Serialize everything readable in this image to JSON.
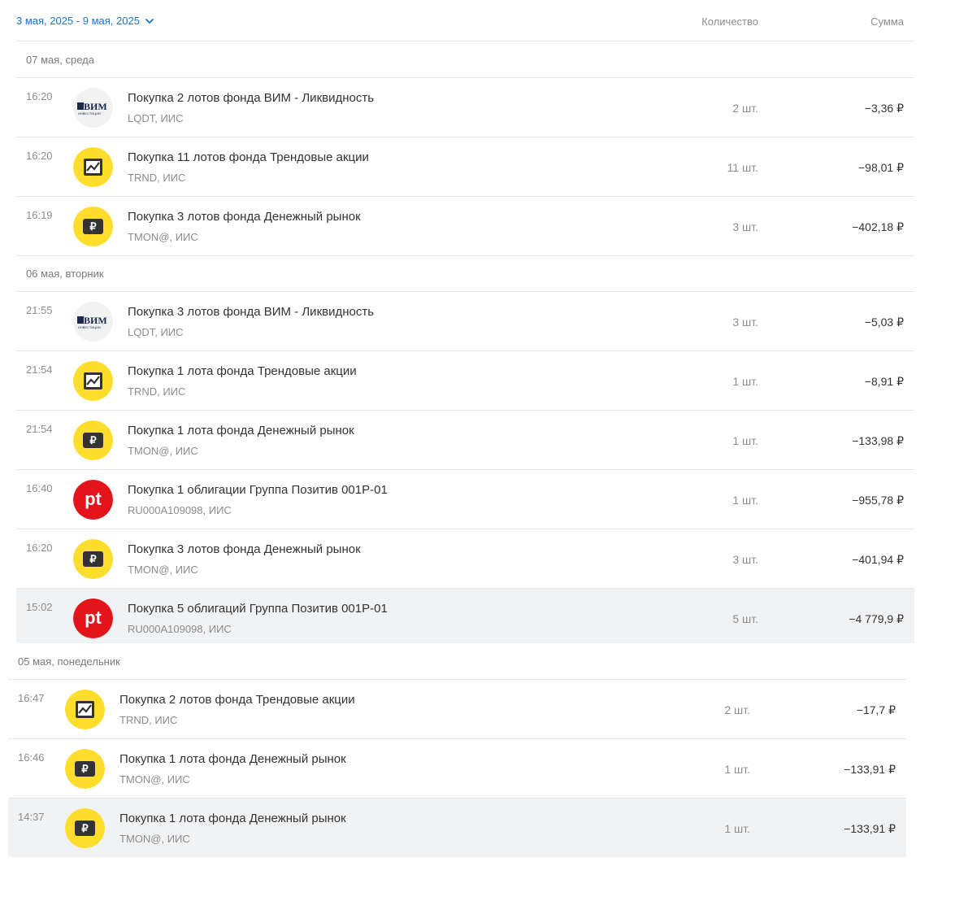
{
  "header": {
    "date_range": "3 мая, 2025 - 9 мая, 2025",
    "col_quantity": "Количество",
    "col_sum": "Сумма"
  },
  "colors": {
    "accent": "#1f74c2",
    "tbank_yellow": "#ffdd2d",
    "pt_red": "#e3151b",
    "highlight_row": "#f1f2f4"
  },
  "days": [
    {
      "label": "07 мая, среда",
      "rows": [
        {
          "time": "16:20",
          "icon": "vim-investments-logo",
          "title": "Покупка 2 лотов фонда ВИМ - Ликвидность",
          "sub": "LQDT, ИИС",
          "qty": "2 шт.",
          "sum": "−3,36 ₽"
        },
        {
          "time": "16:20",
          "icon": "trend-fund-icon",
          "title": "Покупка 11 лотов фонда Трендовые акции",
          "sub": "TRND, ИИС",
          "qty": "11 шт.",
          "sum": "−98,01 ₽"
        },
        {
          "time": "16:19",
          "icon": "money-market-fund-icon",
          "title": "Покупка 3 лотов фонда Денежный рынок",
          "sub": "TMON@, ИИС",
          "qty": "3 шт.",
          "sum": "−402,18 ₽"
        }
      ]
    },
    {
      "label": "06 мая, вторник",
      "rows": [
        {
          "time": "21:55",
          "icon": "vim-investments-logo",
          "title": "Покупка 3 лотов фонда ВИМ - Ликвидность",
          "sub": "LQDT, ИИС",
          "qty": "3 шт.",
          "sum": "−5,03 ₽"
        },
        {
          "time": "21:54",
          "icon": "trend-fund-icon",
          "title": "Покупка 1 лота фонда Трендовые акции",
          "sub": "TRND, ИИС",
          "qty": "1 шт.",
          "sum": "−8,91 ₽"
        },
        {
          "time": "21:54",
          "icon": "money-market-fund-icon",
          "title": "Покупка 1 лота фонда Денежный рынок",
          "sub": "TMON@, ИИС",
          "qty": "1 шт.",
          "sum": "−133,98 ₽"
        },
        {
          "time": "16:40",
          "icon": "positive-technologies-logo",
          "title": "Покупка 1 облигации Группа Позитив 001P-01",
          "sub": "RU000A109098, ИИС",
          "qty": "1 шт.",
          "sum": "−955,78 ₽"
        },
        {
          "time": "16:20",
          "icon": "money-market-fund-icon",
          "title": "Покупка 3 лотов фонда Денежный рынок",
          "sub": "TMON@, ИИС",
          "qty": "3 шт.",
          "sum": "−401,94 ₽"
        },
        {
          "time": "15:02",
          "icon": "positive-technologies-logo",
          "title": "Покупка 5 облигаций Группа Позитив 001P-01",
          "sub": "RU000A109098, ИИС",
          "qty": "5 шт.",
          "sum": "−4 779,9 ₽"
        }
      ]
    },
    {
      "label": "05 мая, понедельник",
      "rows": [
        {
          "time": "16:47",
          "icon": "trend-fund-icon",
          "title": "Покупка 2 лотов фонда Трендовые акции",
          "sub": "TRND, ИИС",
          "qty": "2 шт.",
          "sum": "−17,7 ₽"
        },
        {
          "time": "16:46",
          "icon": "money-market-fund-icon",
          "title": "Покупка 1 лота фонда Денежный рынок",
          "sub": "TMON@, ИИС",
          "qty": "1 шт.",
          "sum": "−133,91 ₽"
        },
        {
          "time": "14:37",
          "icon": "money-market-fund-icon",
          "title": "Покупка 1 лота фонда Денежный рынок",
          "sub": "TMON@, ИИС",
          "qty": "1 шт.",
          "sum": "−133,91 ₽"
        }
      ]
    }
  ],
  "logos": {
    "vim": "ВИМ",
    "vim_sub": "ИНВЕСТИЦИИ",
    "pt": "pt"
  }
}
